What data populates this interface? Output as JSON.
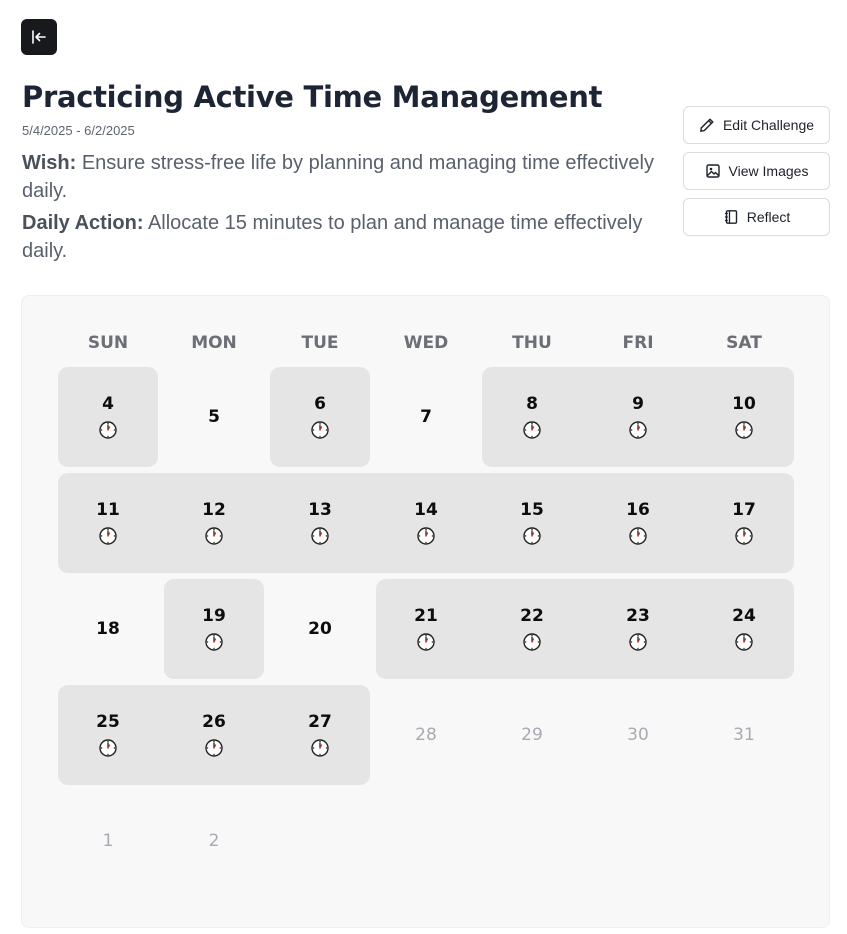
{
  "header": {
    "title": "Practicing Active Time Management",
    "date_range": "5/4/2025 - 6/2/2025",
    "wish_label": "Wish:",
    "wish_text": "Ensure stress-free life by planning and managing time effectively daily.",
    "daily_label": "Daily Action:",
    "daily_text": "Allocate 15 minutes to plan and manage time effectively daily."
  },
  "actions": {
    "edit_label": "Edit Challenge",
    "images_label": "View Images",
    "reflect_label": "Reflect"
  },
  "icons": {
    "back": "arrow-left-to-line-icon",
    "edit": "pencil-icon",
    "images": "image-icon",
    "reflect": "notebook-icon",
    "completed": "clock-icon"
  },
  "colors": {
    "back_button_bg": "#17191d",
    "completed_bg": "#e5e5e5",
    "calendar_bg": "#f8f8f8",
    "clock_hand": "#d12a2a"
  },
  "calendar": {
    "weekdays": [
      "SUN",
      "MON",
      "TUE",
      "WED",
      "THU",
      "FRI",
      "SAT"
    ],
    "weeks": [
      [
        {
          "day": "4",
          "done": true
        },
        {
          "day": "5",
          "done": false
        },
        {
          "day": "6",
          "done": true
        },
        {
          "day": "7",
          "done": false
        },
        {
          "day": "8",
          "done": true
        },
        {
          "day": "9",
          "done": true
        },
        {
          "day": "10",
          "done": true
        }
      ],
      [
        {
          "day": "11",
          "done": true
        },
        {
          "day": "12",
          "done": true
        },
        {
          "day": "13",
          "done": true
        },
        {
          "day": "14",
          "done": true
        },
        {
          "day": "15",
          "done": true
        },
        {
          "day": "16",
          "done": true
        },
        {
          "day": "17",
          "done": true
        }
      ],
      [
        {
          "day": "18",
          "done": false
        },
        {
          "day": "19",
          "done": true
        },
        {
          "day": "20",
          "done": false
        },
        {
          "day": "21",
          "done": true
        },
        {
          "day": "22",
          "done": true
        },
        {
          "day": "23",
          "done": true
        },
        {
          "day": "24",
          "done": true
        }
      ],
      [
        {
          "day": "25",
          "done": true
        },
        {
          "day": "26",
          "done": true
        },
        {
          "day": "27",
          "done": true
        },
        {
          "day": "28",
          "done": false,
          "future": true
        },
        {
          "day": "29",
          "done": false,
          "future": true
        },
        {
          "day": "30",
          "done": false,
          "future": true
        },
        {
          "day": "31",
          "done": false,
          "future": true
        }
      ],
      [
        {
          "day": "1",
          "done": false,
          "future": true
        },
        {
          "day": "2",
          "done": false,
          "future": true
        }
      ]
    ]
  }
}
